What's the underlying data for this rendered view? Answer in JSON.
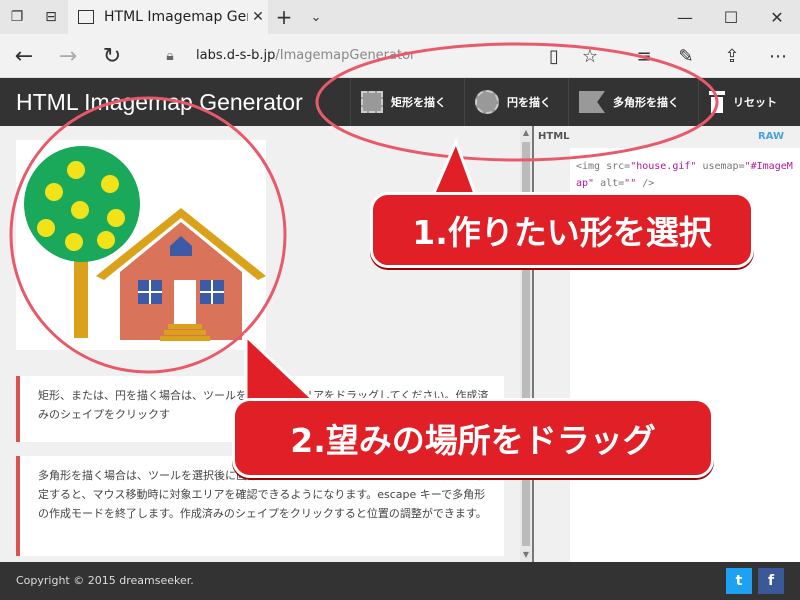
{
  "browser": {
    "tab_title": "HTML Imagemap Gener",
    "url_host": "labs.d-s-b.jp",
    "url_path": "/ImagemapGenerator"
  },
  "app": {
    "title": "HTML Imagemap Generator",
    "tools": {
      "rect": "矩形を描く",
      "circle": "円を描く",
      "poly": "多角形を描く",
      "reset": "リセット"
    }
  },
  "notes": {
    "note1": "矩形、または、円を描く場合は、ツールを選択後にエリアをドラッグしてください。作成済みのシェイプをクリックす",
    "note2": "多角形を描く場合は、ツールを選択後に画像上でクリックしてください。2つめの頂点が確定すると、マウス移動時に対象エリアを確認できるようになります。escape キーで多角形の作成モードを終了します。作成済みのシェイプをクリックすると位置の調整ができます。"
  },
  "code_panel": {
    "label_html": "HTML",
    "label_raw": "RAW",
    "code_start": "<img src=",
    "code_src": "\"house.gif\"",
    "code_usemap_attr": " usemap=",
    "code_usemap_val": "\"#ImageMap\"",
    "code_alt_attr": " alt=",
    "code_alt_val": "\"\"",
    "code_end": " />"
  },
  "footer": {
    "copyright": "Copyright © 2015 dreamseeker.",
    "twitter": "t",
    "facebook": "f"
  },
  "annotations": {
    "callout1": "1.作りたい形を選択",
    "callout2": "2.望みの場所をドラッグ"
  },
  "colors": {
    "header_bg": "#333333",
    "callout_red": "#e01f26",
    "tree_green": "#1aa85a",
    "fruit_yellow": "#f2e21a",
    "house_orange": "#d9735a",
    "roof_gold": "#d9a21a",
    "window_blue": "#3b5ba8"
  }
}
